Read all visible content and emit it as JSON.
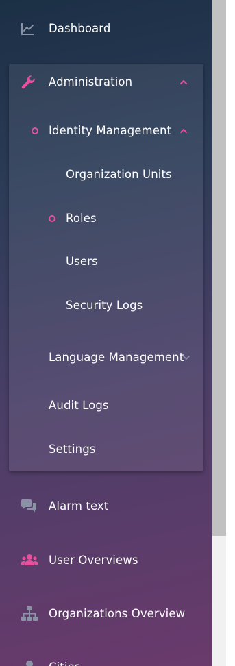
{
  "colors": {
    "accent": "#e84f9c",
    "icon_muted": "#8a93a6",
    "text": "#ffffff"
  },
  "menu": {
    "dashboard": {
      "label": "Dashboard",
      "icon": "chart-line-icon"
    },
    "administration": {
      "label": "Administration",
      "icon": "wrench-icon",
      "expanded": true,
      "children": {
        "identity_management": {
          "label": "Identity Management",
          "expanded": true,
          "children": {
            "organization_units": {
              "label": "Organization Units"
            },
            "roles": {
              "label": "Roles",
              "active": true
            },
            "users": {
              "label": "Users"
            },
            "security_logs": {
              "label": "Security Logs"
            }
          }
        },
        "language_management": {
          "label": "Language Management",
          "expanded": false
        },
        "audit_logs": {
          "label": "Audit Logs"
        },
        "settings": {
          "label": "Settings"
        }
      }
    },
    "alarm_text": {
      "label": "Alarm text",
      "icon": "comments-icon"
    },
    "user_overviews": {
      "label": "User Overviews",
      "icon": "users-icon"
    },
    "organizations_overview": {
      "label": "Organizations Overview",
      "icon": "sitemap-icon"
    },
    "cities": {
      "label": "Cities",
      "icon": "person-icon"
    }
  }
}
